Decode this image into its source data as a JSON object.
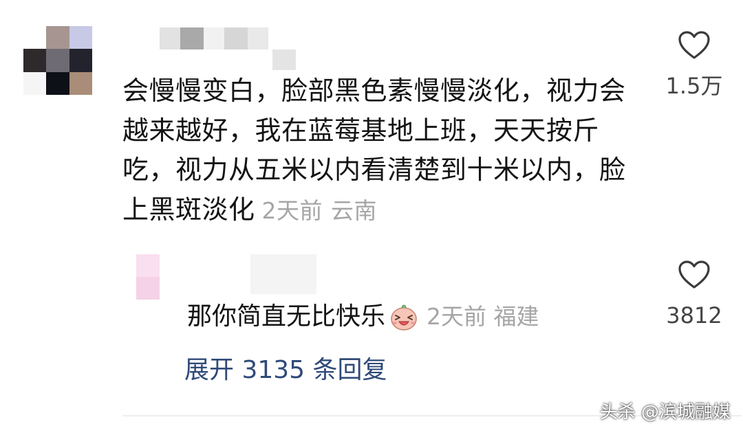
{
  "comment": {
    "avatar_icon": "user-avatar-pixelated",
    "lines": [
      "会慢慢变白，脸部黑色素慢慢淡化，视力会",
      "越来越好，我在蓝莓基地上班，天天按斤",
      "吃，视力从五米以内看清楚到十米以内，脸",
      "上黑斑淡化"
    ],
    "time": "2天前",
    "location": "云南",
    "like_icon": "heart-outline-icon",
    "like_count": "1.5万"
  },
  "reply": {
    "avatar_icon": "user-avatar-pixelated",
    "text": "那你简直无比快乐",
    "emoji_icon": "laughing-face-emoji",
    "time": "2天前",
    "location": "福建",
    "like_icon": "heart-outline-icon",
    "like_count": "3812"
  },
  "expand": {
    "label": "展开 3135 条回复"
  },
  "watermark": {
    "text": "头杀 @滨城融媒"
  },
  "colors": {
    "text": "#141414",
    "meta": "#a6a6a6",
    "link": "#2f4a78",
    "like_count": "#444444"
  }
}
